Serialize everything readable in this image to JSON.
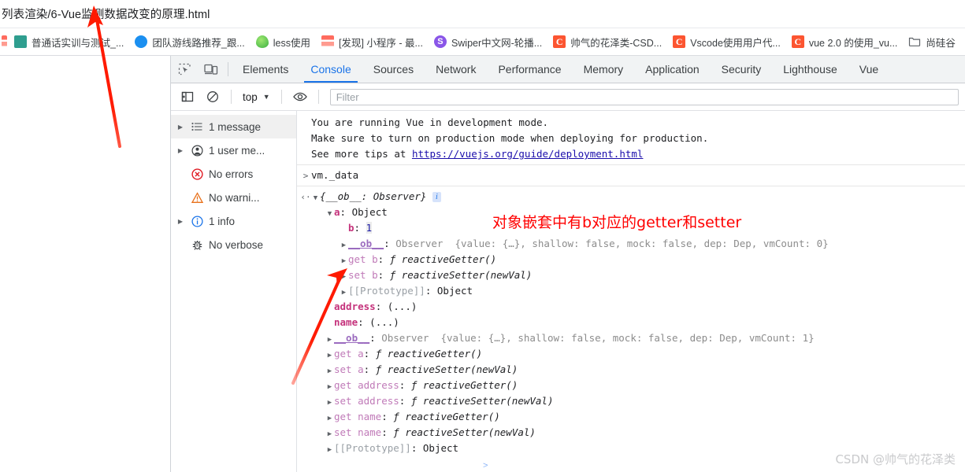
{
  "browser": {
    "address_text": "列表渲染/6-Vue监测数据改变的原理.html",
    "bookmarks": [
      {
        "label": "普通话实训与测试_...",
        "icon": "teal-book-icon"
      },
      {
        "label": "团队游线路推荐_跟...",
        "icon": "blue-circle-icon"
      },
      {
        "label": "less使用",
        "icon": "less-leaf-icon"
      },
      {
        "label": "[发现] 小程序 - 最...",
        "icon": "red-stripes-icon"
      },
      {
        "label": "Swiper中文网-轮播...",
        "icon": "swiper-icon",
        "glyph": "S"
      },
      {
        "label": "帅气的花泽类-CSD...",
        "icon": "csdn-icon",
        "glyph": "C"
      },
      {
        "label": "Vscode使用用户代...",
        "icon": "csdn-icon",
        "glyph": "C"
      },
      {
        "label": "vue 2.0 的使用_vu...",
        "icon": "csdn-icon",
        "glyph": "C"
      },
      {
        "label": "尚硅谷",
        "icon": "folder-icon"
      }
    ]
  },
  "devtools": {
    "inspect_icon": "inspect-element-icon",
    "device_icon": "device-toolbar-icon",
    "tabs": [
      {
        "label": "Elements",
        "active": false
      },
      {
        "label": "Console",
        "active": true
      },
      {
        "label": "Sources",
        "active": false
      },
      {
        "label": "Network",
        "active": false
      },
      {
        "label": "Performance",
        "active": false
      },
      {
        "label": "Memory",
        "active": false
      },
      {
        "label": "Application",
        "active": false
      },
      {
        "label": "Security",
        "active": false
      },
      {
        "label": "Lighthouse",
        "active": false
      },
      {
        "label": "Vue",
        "active": false
      }
    ],
    "toolbar": {
      "sidebar_toggle_icon": "show-console-sidebar-icon",
      "clear_icon": "clear-console-icon",
      "context_value": "top",
      "context_caret": "▼",
      "eye_icon": "live-expression-icon",
      "filter_placeholder": "Filter"
    },
    "sidebar": [
      {
        "label": "1 message",
        "icon": "list-icon",
        "expandable": true,
        "selected": true
      },
      {
        "label": "1 user me...",
        "icon": "user-icon",
        "expandable": true,
        "selected": false
      },
      {
        "label": "No errors",
        "icon": "error-icon",
        "expandable": false,
        "selected": false
      },
      {
        "label": "No warni...",
        "icon": "warning-icon",
        "expandable": false,
        "selected": false
      },
      {
        "label": "1 info",
        "icon": "info-icon",
        "expandable": true,
        "selected": false
      },
      {
        "label": "No verbose",
        "icon": "bug-icon",
        "expandable": false,
        "selected": false
      }
    ],
    "console": {
      "vue_warning": {
        "line1": "You are running Vue in development mode.",
        "line2": "Make sure to turn on production mode when deploying for production.",
        "line3_pre": "See more tips at ",
        "line3_link": "https://vuejs.org/guide/deployment.html"
      },
      "input_prompt": ">",
      "input_expression": "vm._data",
      "result_prompt": "‹·",
      "root": {
        "tri": "▼",
        "label": "{__ob__: Observer}",
        "badge": "i"
      },
      "rows": [
        {
          "indent": 1,
          "tri": "▼",
          "key": "a",
          "sep": ": ",
          "value": "Object",
          "style": "prop"
        },
        {
          "indent": 2,
          "tri": "",
          "key": "b",
          "sep": ": ",
          "value": "1",
          "style": "num-hl"
        },
        {
          "indent": 2,
          "tri": "▶",
          "key": "__ob__",
          "sep": ": ",
          "value": "Observer",
          "extra": "{value: {…}, shallow: false, mock: false, dep: Dep, vmCount: 0}",
          "style": "observer"
        },
        {
          "indent": 2,
          "tri": "▶",
          "key": "get b",
          "sep": ": ",
          "value": "ƒ reactiveGetter()",
          "style": "accessor"
        },
        {
          "indent": 2,
          "tri": "▶",
          "key": "set b",
          "sep": ": ",
          "value": "ƒ reactiveSetter(newVal)",
          "style": "accessor"
        },
        {
          "indent": 2,
          "tri": "▶",
          "key": "[[Prototype]]",
          "sep": ": ",
          "value": "Object",
          "style": "proto"
        },
        {
          "indent": 1,
          "tri": "",
          "key": "address",
          "sep": ": ",
          "value": "(...)",
          "style": "prop"
        },
        {
          "indent": 1,
          "tri": "",
          "key": "name",
          "sep": ": ",
          "value": "(...)",
          "style": "prop"
        },
        {
          "indent": 1,
          "tri": "▶",
          "key": "__ob__",
          "sep": ": ",
          "value": "Observer",
          "extra": "{value: {…}, shallow: false, mock: false, dep: Dep, vmCount: 1}",
          "style": "observer"
        },
        {
          "indent": 1,
          "tri": "▶",
          "key": "get a",
          "sep": ": ",
          "value": "ƒ reactiveGetter()",
          "style": "accessor"
        },
        {
          "indent": 1,
          "tri": "▶",
          "key": "set a",
          "sep": ": ",
          "value": "ƒ reactiveSetter(newVal)",
          "style": "accessor"
        },
        {
          "indent": 1,
          "tri": "▶",
          "key": "get address",
          "sep": ": ",
          "value": "ƒ reactiveGetter()",
          "style": "accessor"
        },
        {
          "indent": 1,
          "tri": "▶",
          "key": "set address",
          "sep": ": ",
          "value": "ƒ reactiveSetter(newVal)",
          "style": "accessor"
        },
        {
          "indent": 1,
          "tri": "▶",
          "key": "get name",
          "sep": ": ",
          "value": "ƒ reactiveGetter()",
          "style": "accessor"
        },
        {
          "indent": 1,
          "tri": "▶",
          "key": "set name",
          "sep": ": ",
          "value": "ƒ reactiveSetter(newVal)",
          "style": "accessor"
        },
        {
          "indent": 1,
          "tri": "▶",
          "key": "[[Prototype]]",
          "sep": ": ",
          "value": "Object",
          "style": "proto"
        }
      ]
    }
  },
  "annotations": {
    "note_text": "对象嵌套中有b对应的getter和setter",
    "arrow_color": "#ff1a00"
  },
  "watermark": "CSDN @帅气的花泽类",
  "colors": {
    "accent": "#1a73e8",
    "annotation_red": "#ff0000",
    "csdn_orange": "#fc5531"
  }
}
